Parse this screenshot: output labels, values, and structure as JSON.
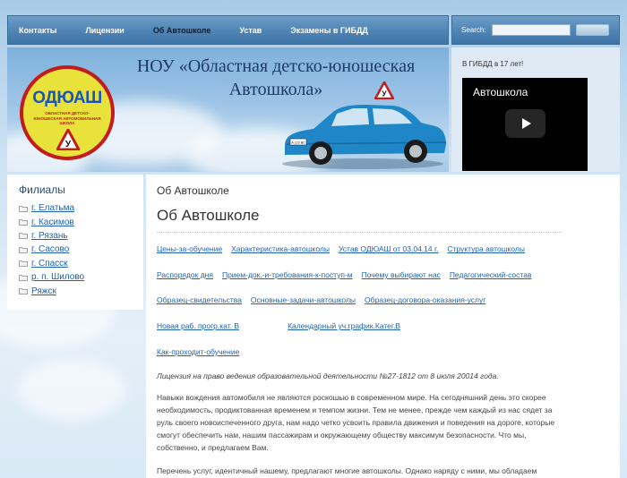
{
  "nav": {
    "items": [
      "Контакты",
      "Лицензии",
      "Об Автошколе",
      "Устав",
      "Экзамены в ГИБДД"
    ],
    "active": "Об Автошколе"
  },
  "search": {
    "label": "Search:",
    "value": "",
    "button": ""
  },
  "banner": {
    "title_line1": "НОУ «Областная детско-юношеская",
    "title_line2": "Автошкола»",
    "logo_title": "ОДЮАШ",
    "logo_subtitle": "ОБЛАСТНАЯ ДЕТСКО-ЮНОШЕСКАЯ АВТОМОБИЛЬНАЯ ШКОЛА",
    "sign_letter": "У",
    "plate": "А 123 ВС"
  },
  "right_panel": {
    "note": "В ГИБДД в 17 лет!",
    "video_title": "Автошкола"
  },
  "sidebar": {
    "title": "Филиалы",
    "items": [
      "г. Елатьма",
      "г. Касимов",
      "г. Рязань",
      "г. Сасово",
      "г. Спасск",
      "р. п. Шилово",
      "Ряжск"
    ]
  },
  "content": {
    "breadcrumb": "Об Автошколе",
    "heading": "Об Автошколе",
    "link_rows": [
      [
        "Цены-за-обучение",
        "Характеристика-автошколы",
        "Устав ОДЮАШ от 03.04.14 г.",
        "Структура автошколы"
      ],
      [
        "Распорядок дня",
        "Прием-док.-и-требования-к-поступ-м",
        "Почему выбирают нас",
        "Педагогический-состав"
      ],
      [
        "Образец-свидетельства",
        "Основные-задачи-автошколы",
        "Образец-договора-оказания-услуг"
      ],
      [
        "Новая раб. прогр.кат. В",
        "Календарный уч.график.Катег.В"
      ],
      [
        "Как-проходит-обучение"
      ]
    ],
    "license": "Лицензия на право ведения образовательной деятельности №27-1812 от 8 июля 20014 года.",
    "paragraph1": "Навыки вождения автомобиля не являются роскошью в современном мире. На сегодняшний день это скорее необходимость, продиктованная временем и темпом жизни. Тем не менее, прежде чем каждый из нас сядет за руль своего новоиспеченного друга, нам надо четко усвоить правила движения и поведения на дороге, которые смогут обеспечить нам, нашим пассажирам и окружающему обществу максимум безопасности. Что мы, собственно, и предлагаем Вам.",
    "paragraph2": "Перечень услуг, идентичный нашему, предлагают многие автошколы. Однако наряду с ними, мы обладаем"
  },
  "colors": {
    "nav": "#4f84b5",
    "link": "#1f63b0",
    "heading": "#1e4a78"
  }
}
